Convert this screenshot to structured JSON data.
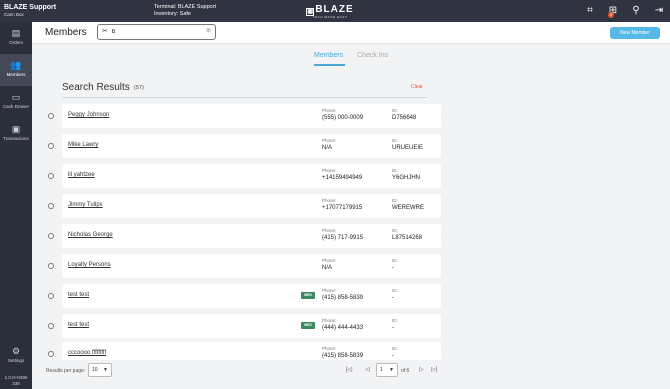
{
  "topbar": {
    "brand_name": "BLAZE Support",
    "brand_sub": "Carin Box",
    "terminal": "Terminal: BLAZE Support",
    "inventory": "Inventory: Safe",
    "logo_text": "BLAZE",
    "logo_tagline": "TECH MADE EASY",
    "notification_count": "0",
    "icons": [
      "barcode-scan-icon",
      "cart-icon",
      "pin-icon",
      "logout-icon"
    ]
  },
  "sidebar": {
    "items": [
      {
        "label": "Orders",
        "icon": "orders-icon"
      },
      {
        "label": "Members",
        "icon": "members-icon"
      },
      {
        "label": "Cash Drawer",
        "icon": "cash-drawer-icon"
      },
      {
        "label": "Transactions",
        "icon": "transactions-icon"
      }
    ],
    "active": "Members",
    "settings_label": "Settings",
    "version_line1": "1.0.0+0495",
    "version_line2": "338"
  },
  "header": {
    "title": "Members",
    "search_value": "b",
    "new_member_label": "New Member"
  },
  "tabs": [
    {
      "label": "Members",
      "active": true
    },
    {
      "label": "Check Ins",
      "active": false
    }
  ],
  "results": {
    "title": "Search Results",
    "count": "(57)",
    "clear_label": "Clear",
    "phone_label": "Phone:",
    "id_label": "ID:",
    "rows": [
      {
        "name": "Peggy Johnson",
        "med": "",
        "phone": "(555) 000-0009",
        "id": "D756648"
      },
      {
        "name": "Mike Lawry",
        "med": "",
        "phone": "N/A",
        "id": "URUEUEIE"
      },
      {
        "name": "lil yahtzee",
        "med": "",
        "phone": "+14159494949",
        "id": "Y6GHJHN"
      },
      {
        "name": "Jimmy Tulips",
        "med": "",
        "phone": "+17077179915",
        "id": "WEREWRE"
      },
      {
        "name": "Nicholas George",
        "med": "",
        "phone": "(415) 717-9915",
        "id": "L87514268"
      },
      {
        "name": "Loyalty  Persons",
        "med": "",
        "phone": "N/A",
        "id": "-"
      },
      {
        "name": "test test",
        "med": "MED",
        "phone": "(415) 858-5839",
        "id": "-"
      },
      {
        "name": "test test",
        "med": "MED",
        "phone": "(444) 444-4433",
        "id": "-"
      },
      {
        "name": "cccoooo fffffffff",
        "med": "",
        "phone": "(415) 858-5839",
        "id": "-"
      }
    ]
  },
  "pagination": {
    "rpp_label": "Results per page:",
    "rpp_value": "10",
    "page_value": "1",
    "page_of": "of 6"
  },
  "colors": {
    "accent": "#4aa7d6",
    "clear": "#e8562a",
    "med_badge": "#3a8a5e",
    "topbar": "#2f3440",
    "sidebar": "#2b2f3a"
  }
}
